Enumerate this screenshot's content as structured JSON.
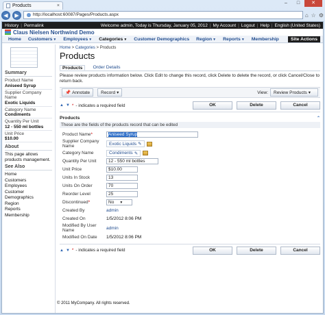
{
  "browser": {
    "tab_title": "Products",
    "address": "http://localhost:60087/Pages/Products.aspx",
    "min": "–",
    "max": "□",
    "close": "✕"
  },
  "membar": {
    "history": "History",
    "permalink": "Permalink",
    "welcome": "Welcome admin, Today is Thursday, January 05, 2012",
    "my_account": "My Account",
    "logout": "Logout",
    "help": "Help",
    "language": "English (United States)"
  },
  "app_title": "Claus Nielsen Northwind Demo",
  "menu": [
    "Home",
    "Customers",
    "Employees",
    "Categories",
    "Customer Demographics",
    "Region",
    "Reports",
    "Membership"
  ],
  "site_actions": "Site Actions",
  "sidebar": {
    "summary_heading": "Summary",
    "fields": [
      {
        "label": "Product Name",
        "value": "Aniseed Syrup"
      },
      {
        "label": "Supplier Company Name",
        "value": "Exotic Liquids"
      },
      {
        "label": "Category Name",
        "value": "Condiments"
      },
      {
        "label": "Quantity Per Unit",
        "value": "12 - 550 ml bottles"
      },
      {
        "label": "Unit Price",
        "value": "$10.00"
      }
    ],
    "about_heading": "About",
    "about_text": "This page allows products management.",
    "see_also_heading": "See Also",
    "links": [
      "Home",
      "Customers",
      "Employees",
      "Customer Demographics",
      "Region",
      "Reports",
      "Membership"
    ]
  },
  "breadcrumb": {
    "home": "Home",
    "categories": "Categories",
    "current": "Products"
  },
  "page_title": "Products",
  "tabs": [
    "Products",
    "Order Details"
  ],
  "description": "Please review products information below. Click Edit to change this record, click Delete to delete the record, or click Cancel/Close to return back.",
  "actions": {
    "annotate": "Annotate",
    "record": "Record",
    "view_label": "View:",
    "view_value": "Review Products"
  },
  "required_note": "- indicates a required field",
  "buttons": {
    "ok": "OK",
    "delete": "Delete",
    "cancel": "Cancel"
  },
  "section": {
    "title": "Products",
    "desc": "These are the fields of the products record that can be edited"
  },
  "form": {
    "product_name": {
      "label": "Product Name",
      "value": "Aniseed Syrup"
    },
    "supplier": {
      "label": "Supplier Company Name",
      "value": "Exotic Liquids"
    },
    "category": {
      "label": "Category Name",
      "value": "Condiments"
    },
    "qpu": {
      "label": "Quantity Per Unit",
      "value": "12 - 550 ml bottles"
    },
    "unit_price": {
      "label": "Unit Price",
      "value": "$10.00"
    },
    "units_stock": {
      "label": "Units In Stock",
      "value": "13"
    },
    "units_order": {
      "label": "Units On Order",
      "value": "70"
    },
    "reorder": {
      "label": "Reorder Level",
      "value": "25"
    },
    "discontinued": {
      "label": "Discontinued",
      "value": "No"
    },
    "created_by": {
      "label": "Created By",
      "value": "admin"
    },
    "created_on": {
      "label": "Created On",
      "value": "1/5/2012 8:06 PM"
    },
    "modified_by": {
      "label": "Modified By User Name",
      "value": "admin"
    },
    "modified_on": {
      "label": "Modified On Date",
      "value": "1/5/2012 8:06 PM"
    }
  },
  "footer": "© 2011 MyCompany. All rights reserved."
}
